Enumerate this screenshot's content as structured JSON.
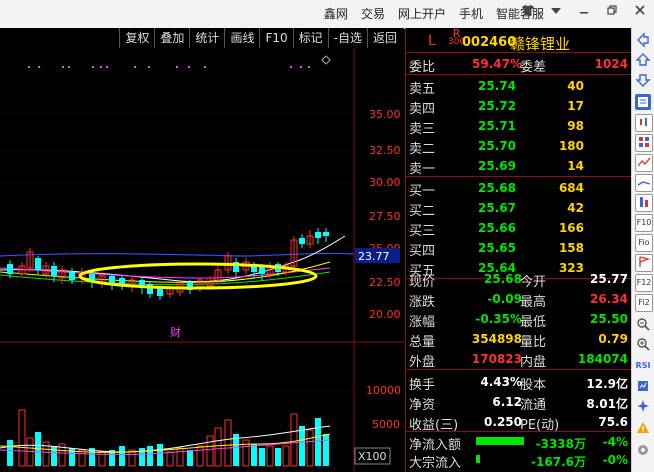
{
  "top_menu": [
    "鑫网",
    "交易",
    "网上开户",
    "手机",
    "智能客服"
  ],
  "window_controls": [
    "shirt-icon",
    "settings-icon",
    "minimize-icon",
    "restore-icon",
    "close-icon"
  ],
  "toolbar": [
    "复权",
    "叠加",
    "统计",
    "画线",
    "F10",
    "标记",
    "-自选",
    "返回"
  ],
  "chart": {
    "price_ticks": [
      "35.00",
      "32.50",
      "30.00",
      "27.50",
      "25.00",
      "22.50",
      "20.00"
    ],
    "current_price_tag": "23.77",
    "volume_ticks": [
      "10000",
      "5000"
    ],
    "volume_unit": "X100",
    "marker_text": "财",
    "highlight_color": "#ffff00",
    "up_color": "#ff3030",
    "down_color": "#00ffff"
  },
  "quote": {
    "market_letter": "L",
    "rz_mark": "R",
    "rz_mark_sub": "300",
    "code": "002460",
    "name": "赣锋锂业",
    "weibi_label": "委比",
    "weibi_value": "59.47%",
    "weicha_label": "委差",
    "weicha_value": "1024",
    "sell": [
      {
        "label": "卖五",
        "price": "25.74",
        "vol": "40"
      },
      {
        "label": "卖四",
        "price": "25.72",
        "vol": "17"
      },
      {
        "label": "卖三",
        "price": "25.71",
        "vol": "98"
      },
      {
        "label": "卖二",
        "price": "25.70",
        "vol": "180"
      },
      {
        "label": "卖一",
        "price": "25.69",
        "vol": "14"
      }
    ],
    "buy": [
      {
        "label": "买一",
        "price": "25.68",
        "vol": "684"
      },
      {
        "label": "买二",
        "price": "25.67",
        "vol": "42"
      },
      {
        "label": "买三",
        "price": "25.66",
        "vol": "166"
      },
      {
        "label": "买四",
        "price": "25.65",
        "vol": "158"
      },
      {
        "label": "买五",
        "price": "25.64",
        "vol": "323"
      }
    ],
    "stats": [
      {
        "l1": "现价",
        "v1": "25.68",
        "c1": "dn",
        "l2": "今开",
        "v2": "25.77",
        "c2": "wh"
      },
      {
        "l1": "涨跌",
        "v1": "-0.09",
        "c1": "dn",
        "l2": "最高",
        "v2": "26.34",
        "c2": "up"
      },
      {
        "l1": "涨幅",
        "v1": "-0.35%",
        "c1": "dn",
        "l2": "最低",
        "v2": "25.50",
        "c2": "dn"
      },
      {
        "l1": "总量",
        "v1": "354898",
        "c1": "yl",
        "l2": "量比",
        "v2": "0.79",
        "c2": "yl"
      },
      {
        "l1": "外盘",
        "v1": "170823",
        "c1": "up",
        "l2": "内盘",
        "v2": "184074",
        "c2": "dn"
      }
    ],
    "stats2": [
      {
        "l1": "换手",
        "v1": "4.43%",
        "c1": "wh",
        "l2": "股本",
        "v2": "12.9亿",
        "c2": "wh"
      },
      {
        "l1": "净资",
        "v1": "6.12",
        "c1": "wh",
        "l2": "流通",
        "v2": "8.01亿",
        "c2": "wh"
      },
      {
        "l1": "收益(三)",
        "v1": "0.250",
        "c1": "wh",
        "l2": "PE(动)",
        "v2": "75.6",
        "c2": "wh"
      }
    ],
    "flow": [
      {
        "label": "净流入额",
        "value": "-3338万",
        "pct": "-4%",
        "bar_color": "#00e600",
        "bar_fraction": 0.62
      },
      {
        "label": "大宗流入",
        "value": "-167.6万",
        "pct": "-0%",
        "bar_color": "#00e600",
        "bar_fraction": 0.05
      }
    ]
  },
  "right_toolbar_icons": [
    "left-arrow-icon",
    "up-arrow-icon",
    "down-arrow-icon",
    "quote-list-icon",
    "kline-icon",
    "grid-icon",
    "line-chart-icon",
    "trend-icon",
    "stock-icon",
    "f10-icon",
    "fio-icon",
    "flag-icon",
    "f12-icon",
    "fio2-icon",
    "zoom-out-icon",
    "zoom-in-icon",
    "rsi-icon",
    "indicator-icon",
    "compass-icon",
    "warning-icon",
    "settings-icon"
  ]
}
